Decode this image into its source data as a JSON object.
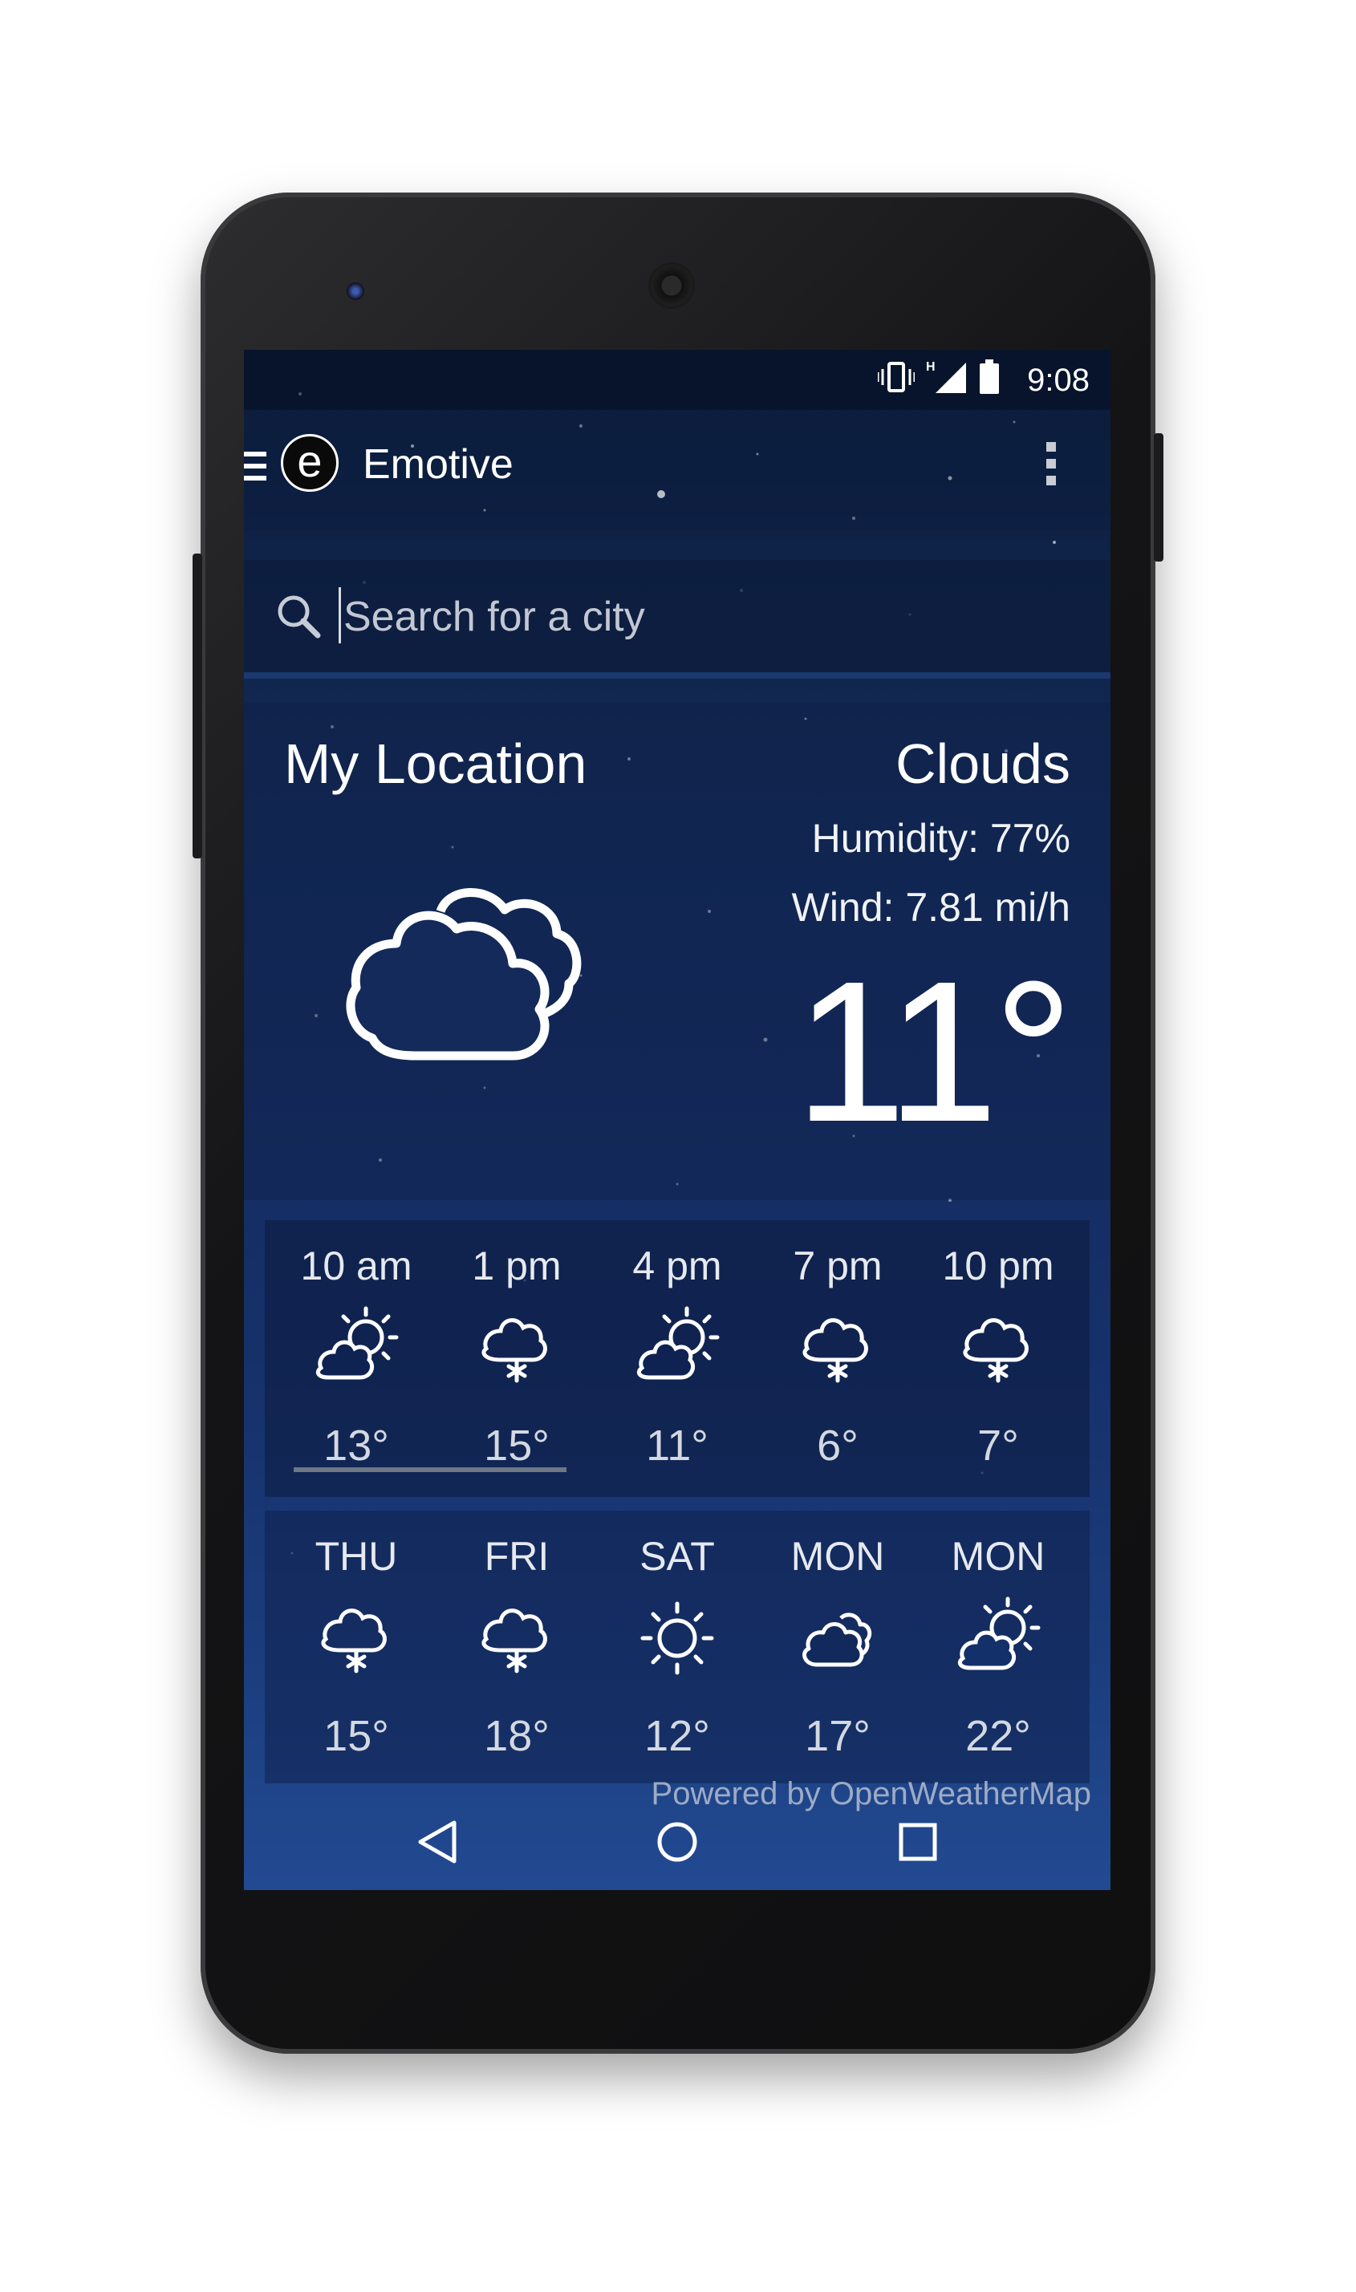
{
  "status_bar": {
    "time": "9:08",
    "network_type": "H"
  },
  "app_bar": {
    "logo_letter": "e",
    "title": "Emotive"
  },
  "search": {
    "placeholder": "Search for a city"
  },
  "current": {
    "location": "My Location",
    "condition": "Clouds",
    "humidity": "Humidity: 77%",
    "wind": "Wind: 7.81 mi/h",
    "temperature": "11°",
    "icon": "clouds-icon"
  },
  "hourly": [
    {
      "label": "10 am",
      "temp": "13°",
      "icon": "partly-cloudy-icon"
    },
    {
      "label": "1 pm",
      "temp": "15°",
      "icon": "snow-icon"
    },
    {
      "label": "4 pm",
      "temp": "11°",
      "icon": "partly-cloudy-icon"
    },
    {
      "label": "7 pm",
      "temp": "6°",
      "icon": "snow-icon"
    },
    {
      "label": "10 pm",
      "temp": "7°",
      "icon": "snow-icon"
    }
  ],
  "daily": [
    {
      "label": "THU",
      "temp": "15°",
      "icon": "snow-icon"
    },
    {
      "label": "FRI",
      "temp": "18°",
      "icon": "snow-icon"
    },
    {
      "label": "SAT",
      "temp": "12°",
      "icon": "sun-icon"
    },
    {
      "label": "MON",
      "temp": "17°",
      "icon": "clouds-icon"
    },
    {
      "label": "MON",
      "temp": "22°",
      "icon": "partly-cloudy-icon"
    }
  ],
  "footer": {
    "powered_by": "Powered by OpenWeatherMap"
  },
  "colors": {
    "screen_top": "#0d1d3c",
    "screen_bottom": "#224a92",
    "text": "#ffffff"
  }
}
